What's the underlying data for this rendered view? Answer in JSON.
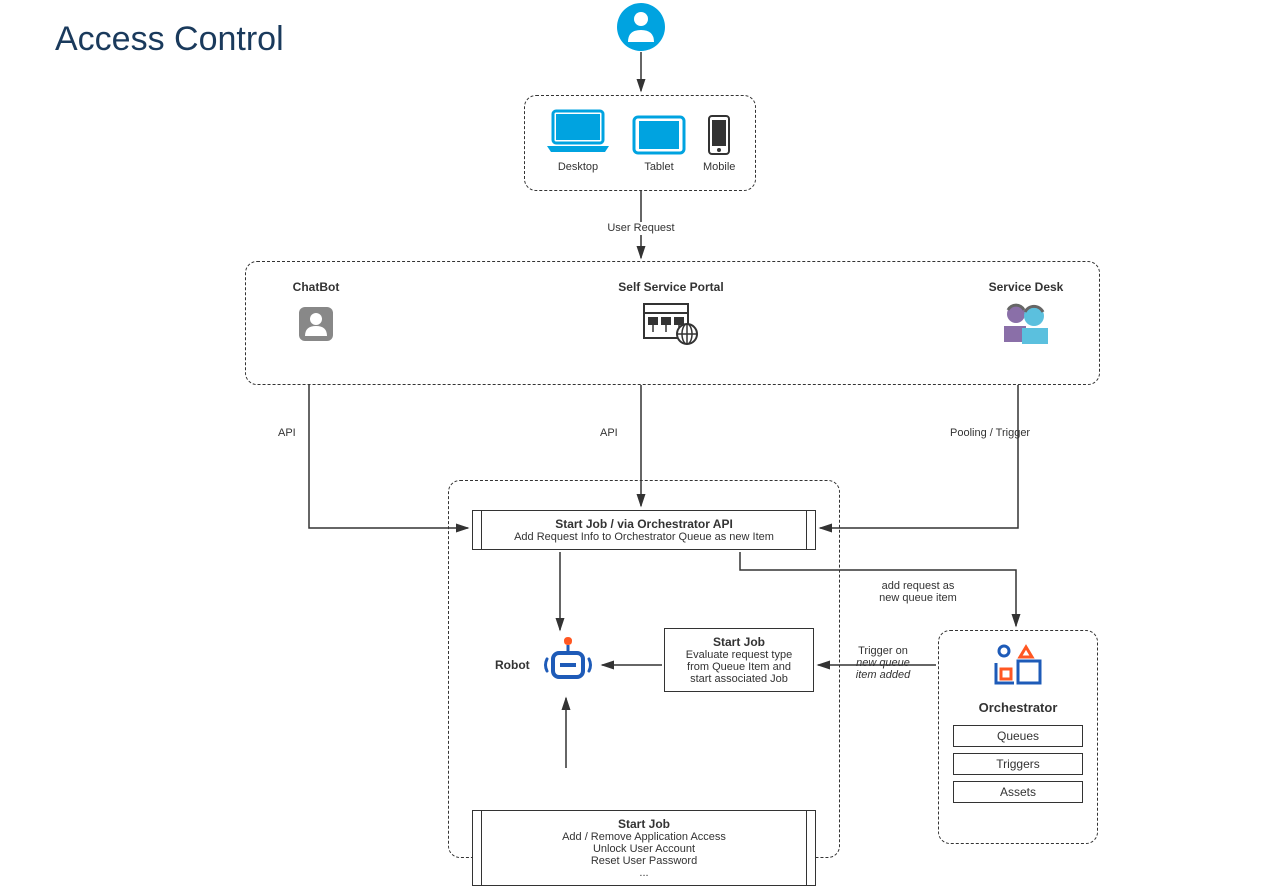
{
  "title": "Access Control",
  "devices": {
    "desktop": "Desktop",
    "tablet": "Tablet",
    "mobile": "Mobile"
  },
  "user_request_label": "User Request",
  "channels": {
    "chatbot": "ChatBot",
    "self_service": "Self Service Portal",
    "service_desk": "Service Desk"
  },
  "edge_labels": {
    "api1": "API",
    "api2": "API",
    "pooling": "Pooling / Trigger",
    "add_request_line1": "add request as",
    "add_request_line2": "new queue item",
    "trigger_line1": "Trigger on",
    "trigger_line2": "new queue",
    "trigger_line3": "item added"
  },
  "start_job_api": {
    "title": "Start Job / via Orchestrator API",
    "sub": "Add Request Info to Orchestrator Queue as new Item"
  },
  "robot_label": "Robot",
  "start_job_eval": {
    "title": "Start Job",
    "line1": "Evaluate request type",
    "line2": "from Queue Item and",
    "line3": "start associated Job"
  },
  "start_job_actions": {
    "title": "Start Job",
    "line1": "Add / Remove Application Access",
    "line2": "Unlock User Account",
    "line3": "Reset User Password",
    "line4": "..."
  },
  "orchestrator": {
    "title": "Orchestrator",
    "queues": "Queues",
    "triggers": "Triggers",
    "assets": "Assets"
  }
}
